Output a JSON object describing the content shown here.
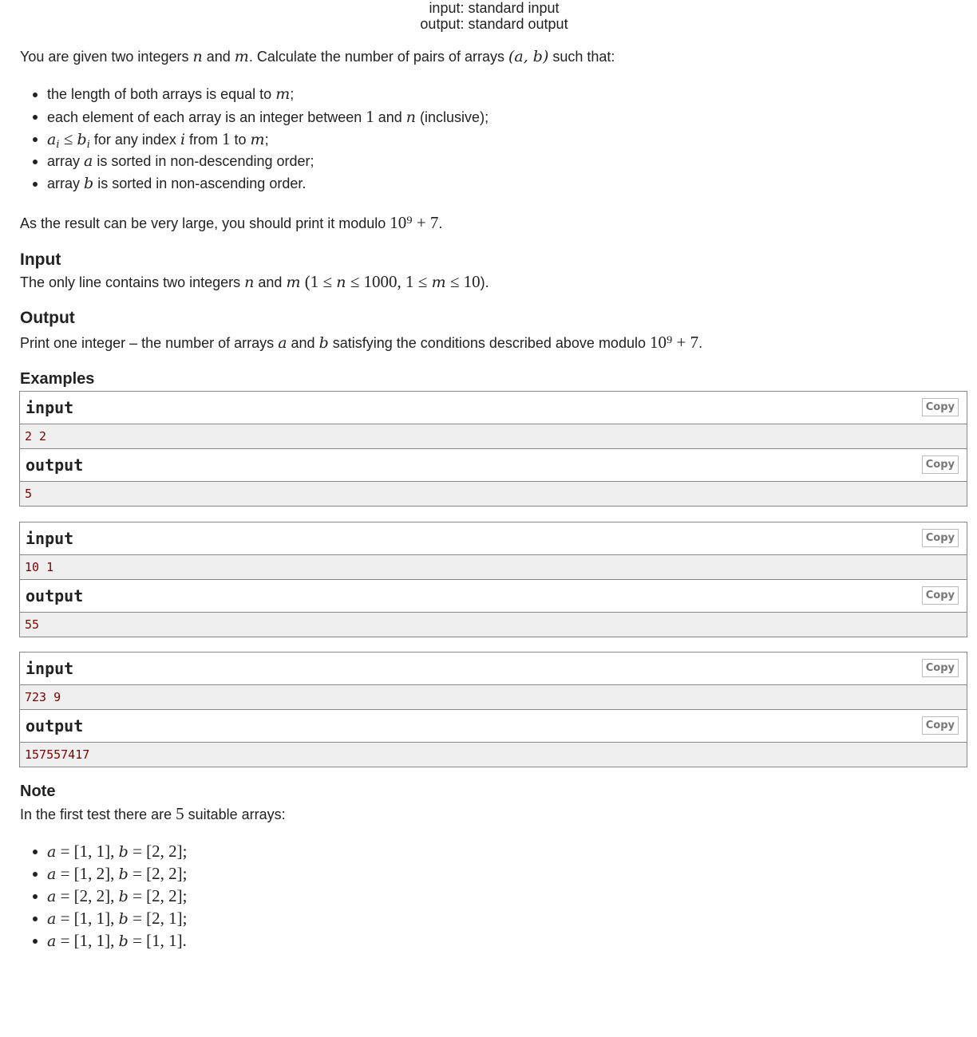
{
  "header": {
    "input_line": "input: standard input",
    "output_line": "output: standard output"
  },
  "statement": {
    "intro": [
      [
        "You are given two integers ",
        0
      ],
      [
        "n",
        1
      ],
      [
        " and ",
        0
      ],
      [
        "m",
        1
      ],
      [
        ". Calculate the number of pairs of arrays ",
        0
      ],
      [
        "(a, b)",
        1
      ],
      [
        " such that:",
        0
      ]
    ],
    "conditions": [
      [
        [
          "the length of both arrays is equal to ",
          0
        ],
        [
          "m",
          1
        ],
        [
          ";",
          0
        ]
      ],
      [
        [
          "each element of each array is an integer between ",
          0
        ],
        [
          "1",
          2
        ],
        [
          " and ",
          0
        ],
        [
          "n",
          1
        ],
        [
          " (inclusive);",
          0
        ]
      ],
      [
        [
          "a",
          1
        ],
        [
          "i",
          1
        ],
        [
          " ≤ ",
          2
        ],
        [
          "b",
          1
        ],
        [
          "i",
          1
        ],
        [
          " for any index ",
          0
        ],
        [
          "i",
          1
        ],
        [
          " from ",
          0
        ],
        [
          "1",
          2
        ],
        [
          " to ",
          0
        ],
        [
          "m",
          1
        ],
        [
          ";",
          0
        ]
      ],
      [
        [
          "array ",
          0
        ],
        [
          "a",
          1
        ],
        [
          " is sorted in non-descending order;",
          0
        ]
      ],
      [
        [
          "array ",
          0
        ],
        [
          "b",
          1
        ],
        [
          " is sorted in non-ascending order.",
          0
        ]
      ]
    ],
    "modulo": [
      [
        "As the result can be very large, you should print it modulo ",
        0
      ],
      [
        "10⁹ + 7",
        2
      ],
      [
        ".",
        0
      ]
    ]
  },
  "input_section": {
    "title": "Input",
    "text": [
      [
        "The only line contains two integers ",
        0
      ],
      [
        "n",
        1
      ],
      [
        " and ",
        0
      ],
      [
        "m",
        1
      ],
      [
        " (1 ≤ ",
        2
      ],
      [
        "n",
        1
      ],
      [
        " ≤ 1000, 1 ≤ ",
        2
      ],
      [
        "m",
        1
      ],
      [
        " ≤ 10",
        2
      ],
      [
        ").",
        0
      ]
    ]
  },
  "output_section": {
    "title": "Output",
    "text": [
      [
        "Print one integer – the number of arrays ",
        0
      ],
      [
        "a",
        1
      ],
      [
        " and ",
        0
      ],
      [
        "b",
        1
      ],
      [
        " satisfying the conditions described above modulo ",
        0
      ],
      [
        "10⁹ + 7",
        2
      ],
      [
        ".",
        0
      ]
    ]
  },
  "examples": {
    "title": "Examples",
    "input_label": "input",
    "output_label": "output",
    "copy_label": "Copy",
    "items": [
      {
        "input": "2 2",
        "output": "5"
      },
      {
        "input": "10 1",
        "output": "55"
      },
      {
        "input": "723 9",
        "output": "157557417"
      }
    ]
  },
  "note": {
    "title": "Note",
    "text": [
      [
        "In the first test there are ",
        0
      ],
      [
        "5",
        2
      ],
      [
        " suitable arrays:",
        0
      ]
    ],
    "items": [
      [
        [
          "a",
          1
        ],
        [
          " = [1, 1], ",
          2
        ],
        [
          "b",
          1
        ],
        [
          " = [2, 2];",
          2
        ]
      ],
      [
        [
          "a",
          1
        ],
        [
          " = [1, 2], ",
          2
        ],
        [
          "b",
          1
        ],
        [
          " = [2, 2];",
          2
        ]
      ],
      [
        [
          "a",
          1
        ],
        [
          " = [2, 2], ",
          2
        ],
        [
          "b",
          1
        ],
        [
          " = [2, 2];",
          2
        ]
      ],
      [
        [
          "a",
          1
        ],
        [
          " = [1, 1], ",
          2
        ],
        [
          "b",
          1
        ],
        [
          " = [2, 1];",
          2
        ]
      ],
      [
        [
          "a",
          1
        ],
        [
          " = [1, 1], ",
          2
        ],
        [
          "b",
          1
        ],
        [
          " = [1, 1].",
          2
        ]
      ]
    ]
  }
}
